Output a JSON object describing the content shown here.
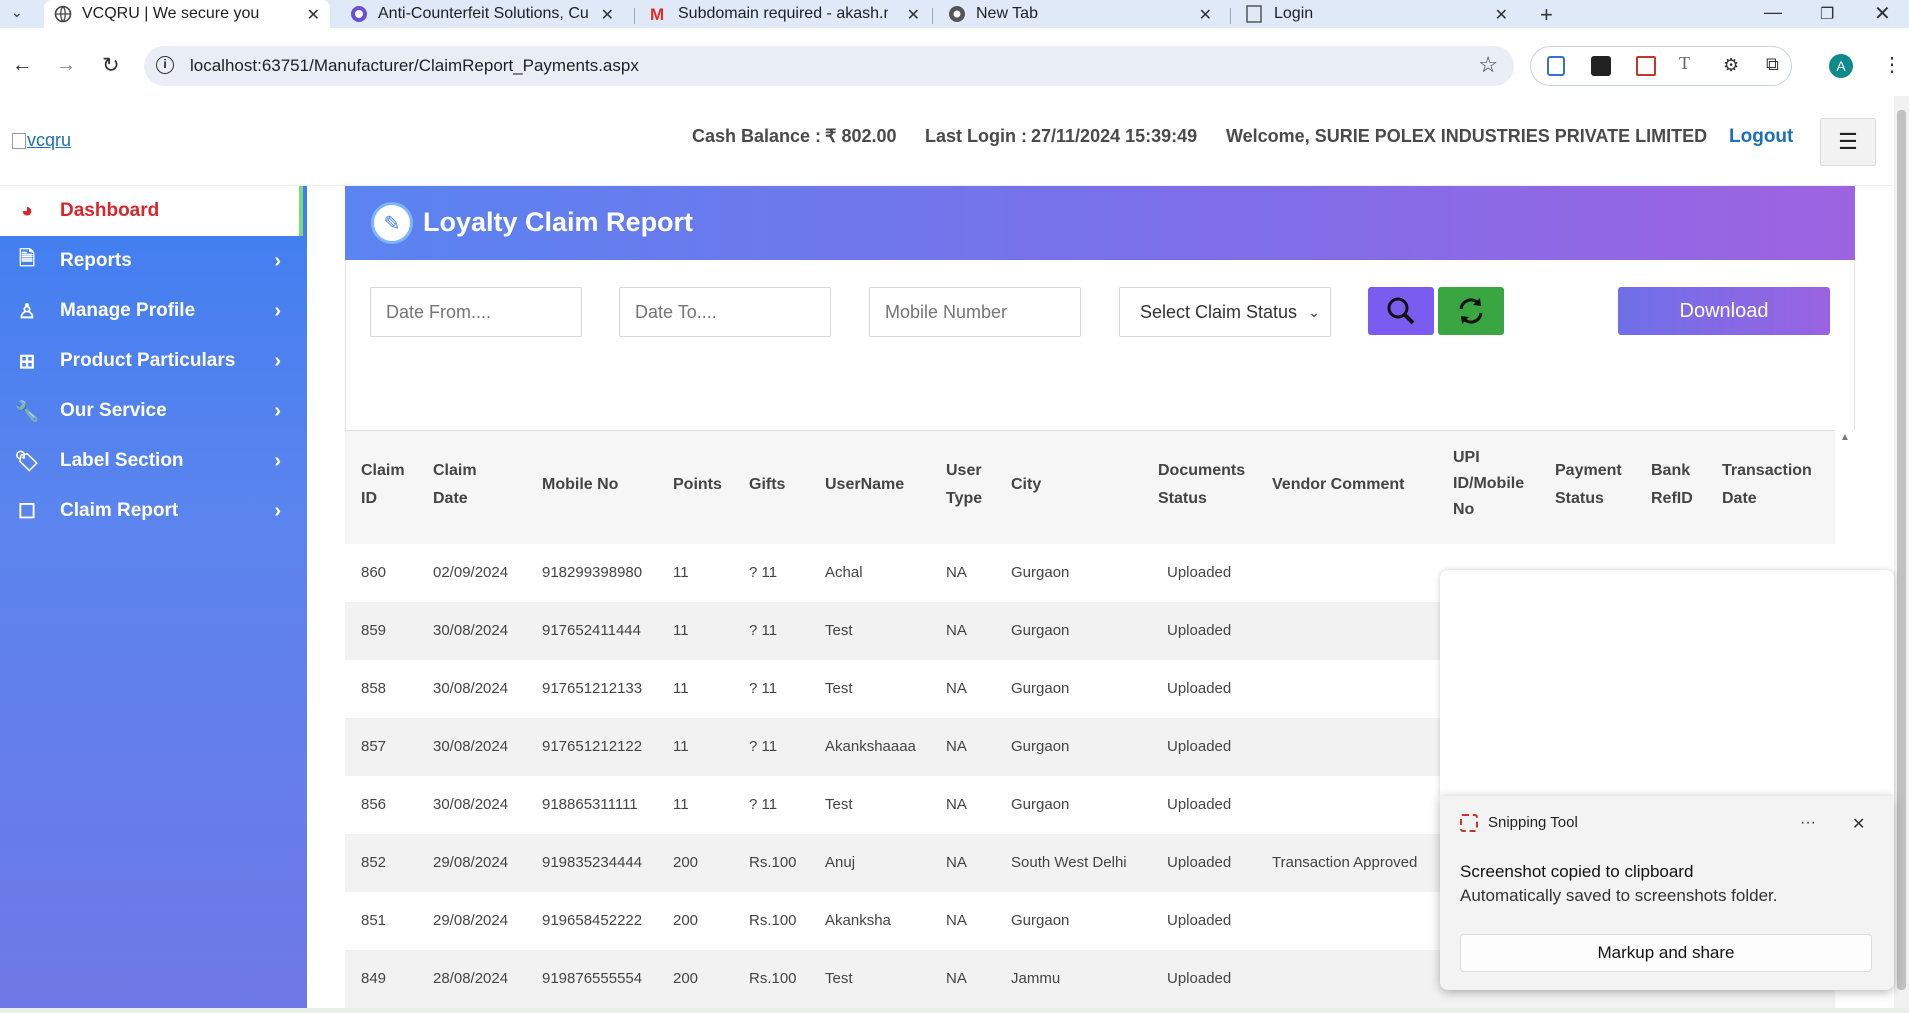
{
  "browser": {
    "tabs": [
      {
        "title": "VCQRU | We secure you",
        "active": true
      },
      {
        "title": "Anti-Counterfeit Solutions, Cust",
        "active": false
      },
      {
        "title": "Subdomain required - akash.m",
        "active": false
      },
      {
        "title": "New Tab",
        "active": false
      },
      {
        "title": "Login",
        "active": false
      }
    ],
    "url": "localhost:63751/Manufacturer/ClaimReport_Payments.aspx",
    "profile_initial": "A"
  },
  "header": {
    "logo_alt": "vcqru",
    "cash_balance_label": "Cash Balance :",
    "cash_balance_value": "₹  802.00",
    "last_login_label": "Last Login :",
    "last_login_value": "27/11/2024 15:39:49",
    "welcome": "Welcome, SURIE POLEX INDUSTRIES PRIVATE LIMITED",
    "logout": "Logout"
  },
  "sidebar": {
    "items": [
      {
        "label": "Dashboard",
        "icon": "dashboard-icon"
      },
      {
        "label": "Reports",
        "icon": "file-icon"
      },
      {
        "label": "Manage Profile",
        "icon": "user-icon"
      },
      {
        "label": "Product Particulars",
        "icon": "basket-icon"
      },
      {
        "label": "Our Service",
        "icon": "wrench-icon"
      },
      {
        "label": "Label Section",
        "icon": "tags-icon"
      },
      {
        "label": "Claim Report",
        "icon": "note-icon"
      }
    ]
  },
  "page": {
    "title": "Loyalty Claim Report"
  },
  "filters": {
    "date_from_placeholder": "Date From....",
    "date_to_placeholder": "Date To....",
    "mobile_placeholder": "Mobile Number",
    "status_selected": "Select Claim Status",
    "download": "Download"
  },
  "table": {
    "headers": {
      "claim_id": [
        "Claim",
        "ID"
      ],
      "claim_date": [
        "Claim",
        "Date"
      ],
      "mobile": "Mobile No",
      "points": "Points",
      "gifts": "Gifts",
      "username": "UserName",
      "user_type": [
        "User",
        "Type"
      ],
      "city": "City",
      "documents": [
        "Documents",
        "Status"
      ],
      "vendor_comment": "Vendor Comment",
      "upi": [
        "UPI",
        "ID/Mobile",
        "No"
      ],
      "payment_status": [
        "Payment",
        "Status"
      ],
      "bank_refid": [
        "Bank",
        "RefID"
      ],
      "transaction_date": [
        "Transaction",
        "Date"
      ]
    },
    "rows": [
      {
        "id": "860",
        "date": "02/09/2024",
        "mobile": "918299398980",
        "points": "11",
        "gifts": "? 11",
        "username": "Achal",
        "type": "NA",
        "city": "Gurgaon",
        "docs": "Uploaded",
        "comment": ""
      },
      {
        "id": "859",
        "date": "30/08/2024",
        "mobile": "917652411444",
        "points": "11",
        "gifts": "? 11",
        "username": "Test",
        "type": "NA",
        "city": "Gurgaon",
        "docs": "Uploaded",
        "comment": ""
      },
      {
        "id": "858",
        "date": "30/08/2024",
        "mobile": "917651212133",
        "points": "11",
        "gifts": "? 11",
        "username": "Test",
        "type": "NA",
        "city": "Gurgaon",
        "docs": "Uploaded",
        "comment": ""
      },
      {
        "id": "857",
        "date": "30/08/2024",
        "mobile": "917651212122",
        "points": "11",
        "gifts": "? 11",
        "username": "Akankshaaaa",
        "type": "NA",
        "city": "Gurgaon",
        "docs": "Uploaded",
        "comment": ""
      },
      {
        "id": "856",
        "date": "30/08/2024",
        "mobile": "918865311111",
        "points": "11",
        "gifts": "? 11",
        "username": "Test",
        "type": "NA",
        "city": "Gurgaon",
        "docs": "Uploaded",
        "comment": ""
      },
      {
        "id": "852",
        "date": "29/08/2024",
        "mobile": "919835234444",
        "points": "200",
        "gifts": "Rs.100",
        "username": "Anuj",
        "type": "NA",
        "city": "South West Delhi",
        "docs": "Uploaded",
        "comment": "Transaction Approved"
      },
      {
        "id": "851",
        "date": "29/08/2024",
        "mobile": "919658452222",
        "points": "200",
        "gifts": "Rs.100",
        "username": "Akanksha",
        "type": "NA",
        "city": "Gurgaon",
        "docs": "Uploaded",
        "comment": ""
      },
      {
        "id": "849",
        "date": "28/08/2024",
        "mobile": "919876555554",
        "points": "200",
        "gifts": "Rs.100",
        "username": "Test",
        "type": "NA",
        "city": "Jammu",
        "docs": "Uploaded",
        "comment": ""
      }
    ]
  },
  "toast": {
    "app": "Snipping Tool",
    "title": "Screenshot copied to clipboard",
    "body": "Automatically saved to screenshots folder.",
    "button": "Markup and share",
    "more": "···",
    "close": "✕"
  }
}
